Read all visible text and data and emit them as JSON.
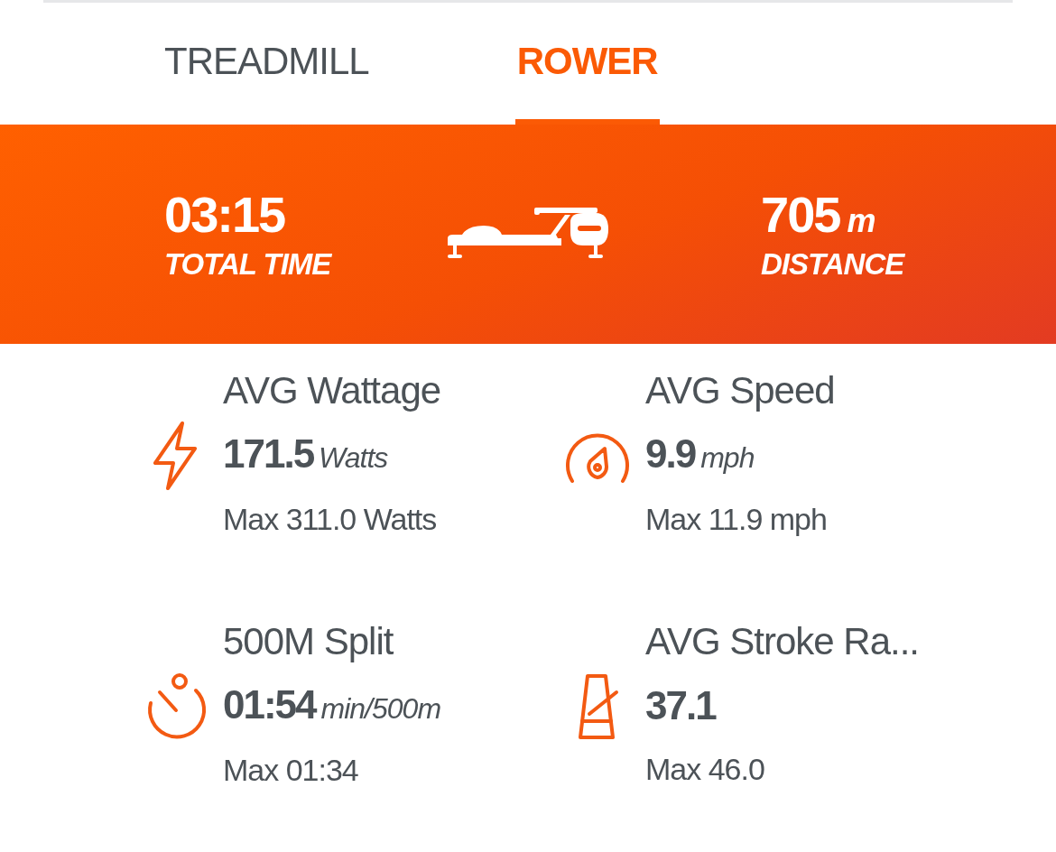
{
  "tabs": [
    {
      "label": "TREADMILL",
      "selected": false
    },
    {
      "label": "ROWER",
      "selected": true
    }
  ],
  "summary": {
    "time": {
      "value": "03:15",
      "label": "TOTAL TIME"
    },
    "distance": {
      "value": "705",
      "unit": "m",
      "label": "DISTANCE"
    }
  },
  "metrics": [
    {
      "kind": "power",
      "title": "AVG Wattage",
      "value": "171.5",
      "unit": "Watts",
      "max": "Max 311.0 Watts"
    },
    {
      "kind": "speed",
      "title": "AVG Speed",
      "value": "9.9",
      "unit": "mph",
      "max": "Max 11.9 mph"
    },
    {
      "kind": "split",
      "title": "500M Split",
      "value": "01:54",
      "unit": "min/500m",
      "max": "Max 01:34"
    },
    {
      "kind": "stroke",
      "title": "AVG Stroke Ra...",
      "value": "37.1",
      "max": "Max 46.0"
    }
  ]
}
